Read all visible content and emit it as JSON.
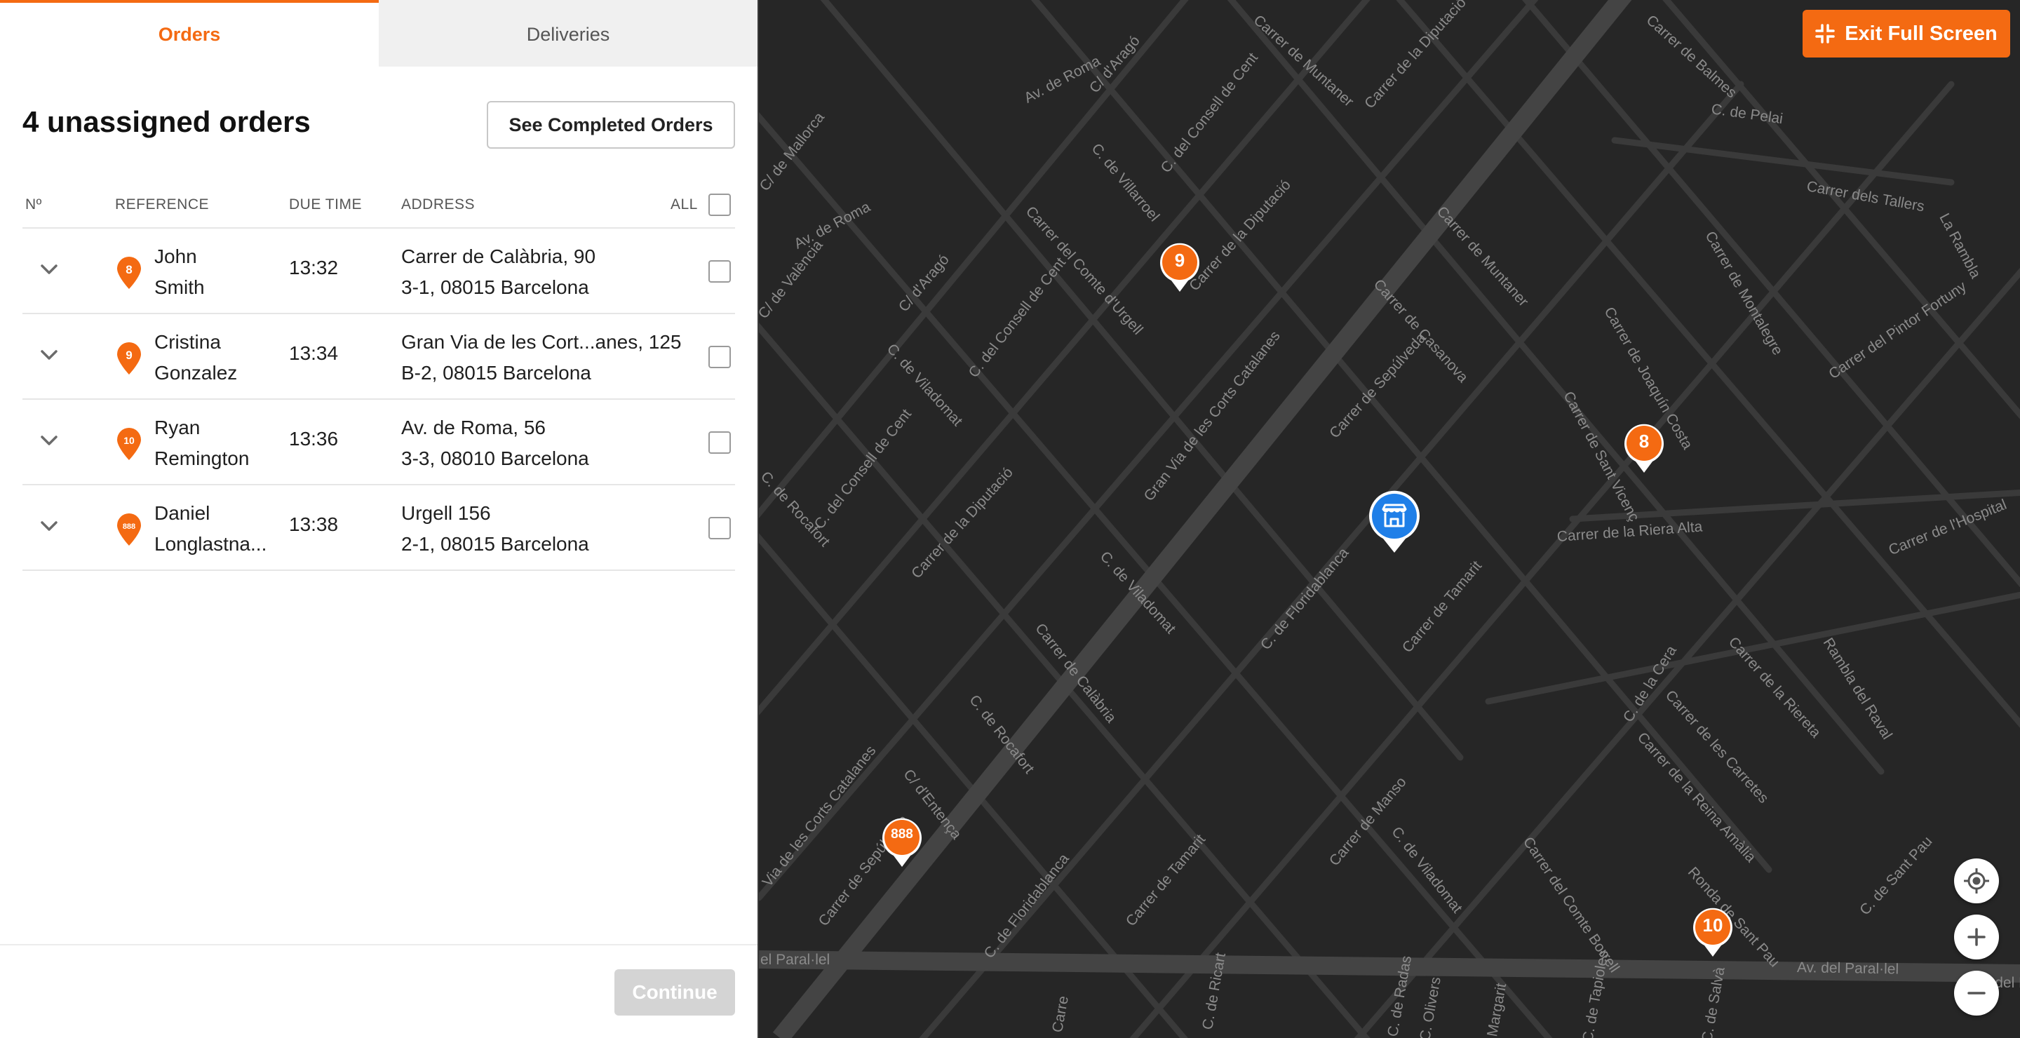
{
  "tabs": [
    {
      "label": "Orders",
      "active": true
    },
    {
      "label": "Deliveries",
      "active": false
    }
  ],
  "header": {
    "title": "4 unassigned orders",
    "completed_button": "See Completed Orders"
  },
  "table": {
    "columns": {
      "number": "Nº",
      "reference": "REFERENCE",
      "due_time": "DUE TIME",
      "address": "ADDRESS",
      "all": "ALL"
    },
    "rows": [
      {
        "badge": "8",
        "name_line1": "John",
        "name_line2": "Smith",
        "due": "13:32",
        "addr_line1": "Carrer de Calàbria, 90",
        "addr_line2": "3-1, 08015 Barcelona"
      },
      {
        "badge": "9",
        "name_line1": "Cristina",
        "name_line2": "Gonzalez",
        "due": "13:34",
        "addr_line1": "Gran Via de les Cort...anes, 125",
        "addr_line2": "B-2, 08015 Barcelona"
      },
      {
        "badge": "10",
        "name_line1": "Ryan",
        "name_line2": "Remington",
        "due": "13:36",
        "addr_line1": "Av. de Roma, 56",
        "addr_line2": "3-3, 08010 Barcelona"
      },
      {
        "badge": "888",
        "name_line1": "Daniel",
        "name_line2": "Longlastna...",
        "due": "13:38",
        "addr_line1": "Urgell 156",
        "addr_line2": "2-1, 08015 Barcelona"
      }
    ]
  },
  "footer": {
    "continue_label": "Continue"
  },
  "map": {
    "exit_label": "Exit Full Screen",
    "markers": [
      "9",
      "8",
      "888",
      "10"
    ],
    "store_icon": "store-icon",
    "street_labels": [
      "C/ d'Aragó",
      "Av. de Roma",
      "C. de Villarroel",
      "C. del Consell de Cent",
      "Carrer de Muntaner",
      "Carrer de la Diputació",
      "Carrer de Balmes",
      "C. de Pelai",
      "Carrer dels Tallers",
      "La Rambla",
      "C/ de Mallorca",
      "Av. de Roma",
      "C/ de València",
      "C/ d'Aragó",
      "Carrer del Comte d'Urgell",
      "Carrer de la Diputació",
      "C. del Consell de Cent",
      "C. de Viladomat",
      "Carrer de Muntaner",
      "Carrer de Casanova",
      "Carrer de Sepúlveda",
      "Gran Via de les Corts Catalanes",
      "Carrer de Montalegre",
      "Carrer de Joaquín Costa",
      "Carrer del Pintor Fortuny",
      "Carrer de Sant Vicenç",
      "Carrer de la Riera Alta",
      "Carrer de l'Hospital",
      "C. de Rocafort",
      "C. del Consell de Cent",
      "Carrer de la Diputació",
      "C. de Viladomat",
      "C. de Floridablanca",
      "Carrer de Tamarit",
      "Carrer de Calàbria",
      "C. de Rocafort",
      "C/ d'Entença",
      "Via de les Corts Catalanes",
      "Carrer de Sepúlveda",
      "C. de Floridablanca",
      "Carrer de Tamarit",
      "Carrer de Manso",
      "C. de Viladomat",
      "Carrer del Comte Borrell",
      "C. de la Cera",
      "Carrer de les Carretes",
      "Carrer de la Reina Amàlia",
      "Carrer de la Riereta",
      "Rambla del Raval",
      "Ronda de Sant Pau",
      "C. de Sant Pau",
      "el Paral·lel",
      "Av. del Paral·lel",
      "Carre",
      "C. de Ricart",
      "C. de Radas",
      "C. Olivers",
      "Margarit",
      "C. de Tapioles",
      "C. de Salvà",
      "Av. del Pa"
    ]
  },
  "colors": {
    "accent": "#f46a12",
    "store_marker": "#1f7fe8",
    "map_bg": "#262626"
  }
}
